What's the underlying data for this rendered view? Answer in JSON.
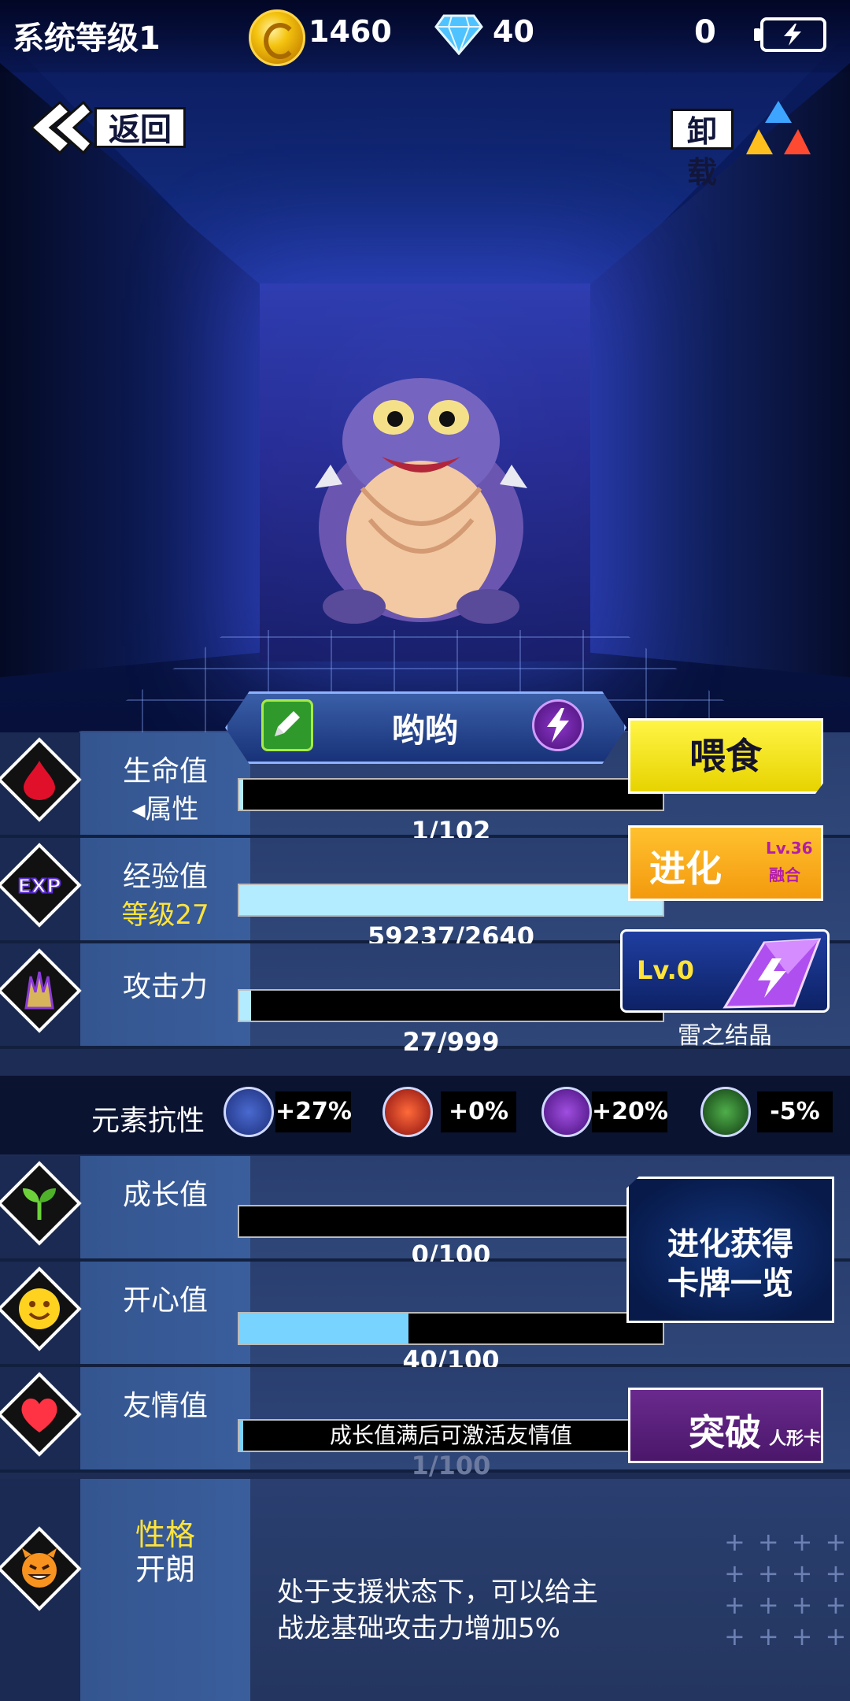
{
  "topbar": {
    "system_level": "系统等级1",
    "coins": "1460",
    "gems": "40",
    "energy": "0"
  },
  "nav": {
    "back_label": "返回",
    "unload_label": "卸载"
  },
  "pet": {
    "name": "哟哟"
  },
  "stats": {
    "hp": {
      "label": "生命值",
      "sub": "◂属性",
      "value": "1/102",
      "progress": 0.01
    },
    "exp": {
      "label": "经验值",
      "sub": "等级27",
      "value": "59237/2640",
      "progress": 1.0
    },
    "attack": {
      "label": "攻击力",
      "value": "27/999",
      "progress": 0.027
    },
    "growth": {
      "label": "成长值",
      "value": "0/100",
      "progress": 0.0
    },
    "happy": {
      "label": "开心值",
      "value": "40/100",
      "progress": 0.4
    },
    "friendship": {
      "label": "友情值",
      "bar_text": "成长值满后可激活友情值",
      "value": "1/100",
      "progress": 0.01
    }
  },
  "resist": {
    "label": "元素抗性",
    "items": [
      {
        "icon": "water-shield-icon",
        "value": "+27%"
      },
      {
        "icon": "fire-icon",
        "value": "+0%"
      },
      {
        "icon": "thunder-icon",
        "value": "+20%"
      },
      {
        "icon": "poison-icon",
        "value": "-5%"
      }
    ]
  },
  "buttons": {
    "feed": "喂食",
    "evolve": "进化",
    "evolve_sub1": "Lv.36",
    "evolve_sub2": "融合",
    "crystal_lv": "Lv.0",
    "crystal_name": "雷之结晶",
    "cards_line1": "进化获得",
    "cards_line2": "卡牌一览",
    "breakthrough": "突破",
    "breakthrough_sub": "人形卡"
  },
  "personality": {
    "label": "性格",
    "value": "开朗",
    "desc_line1": "处于支援状态下，可以给主",
    "desc_line2": "战龙基础攻击力增加5%"
  },
  "colors": {
    "bar_cyan": "#b4ecff",
    "bar_blue": "#79d3ff",
    "feed_yellow": "#f5e61d",
    "evolve_orange": "#f7a91a",
    "accent_yellow": "#ffe33a"
  }
}
